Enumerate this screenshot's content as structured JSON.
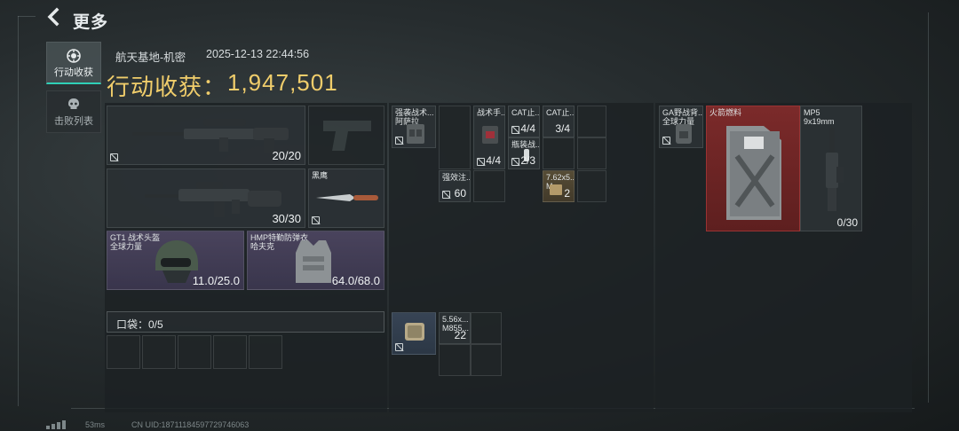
{
  "header": {
    "title": "更多",
    "back_icon": "chevron-left-icon"
  },
  "nav": [
    {
      "label": "行动收获",
      "icon": "loot-icon",
      "active": true
    },
    {
      "label": "击败列表",
      "icon": "skull-icon",
      "active": false
    }
  ],
  "summary": {
    "location": "航天基地-机密",
    "datetime": "2025-12-13 22:44:56",
    "loot_label": "行动收获：",
    "loot_value": "1,947,501"
  },
  "equipment": {
    "primary1": {
      "count": "20/20"
    },
    "primary2": {
      "count": "30/30"
    },
    "melee": {
      "name": "黑鹰"
    },
    "helmet": {
      "name1": "GT1 战术头盔",
      "name2": "全球力量",
      "durability": "11.0/25.0"
    },
    "armor": {
      "name1": "HMP特勤防弹衣",
      "name2": "哈夫克",
      "durability": "64.0/68.0"
    },
    "pocket": {
      "label": "口袋：0/5"
    }
  },
  "chest_rig": {
    "rig": {
      "name1": "强袭战术...",
      "name2": "阿萨拉"
    },
    "items": [
      {
        "name": "战术手...",
        "count": "4/4"
      },
      {
        "name": "CAT止...",
        "count": "4/4"
      },
      {
        "name": "CAT止...",
        "count": "3/4"
      },
      {
        "name": "瓶装战...",
        "count": "2/3"
      },
      {
        "name": "强效注...",
        "count": "60"
      },
      {
        "name": "7.62x5...",
        "name2": "M...",
        "count": "2"
      }
    ]
  },
  "backpack_section": {
    "pouch_icon": "pouch-icon",
    "ammo": {
      "name1": "5.56x...",
      "name2": "M855...",
      "count": "22"
    }
  },
  "backpack": {
    "pack": {
      "name1": "GA野战背...",
      "name2": "全球力量"
    },
    "fuel": {
      "name": "火箭燃料"
    },
    "smg": {
      "name1": "MP5",
      "name2": "9x19mm",
      "count": "0/30"
    }
  },
  "footer": {
    "ping": "53ms",
    "uid": "CN UID:18711184597729746063"
  },
  "colors": {
    "gold": "#f0cd6b",
    "accent": "#2fd0b7",
    "red_item": "#7b2a2a"
  }
}
